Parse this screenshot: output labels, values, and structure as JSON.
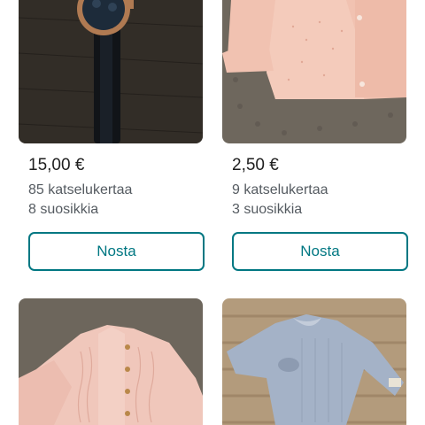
{
  "listings": [
    {
      "image": "wristwatch-photo",
      "price": "15,00 €",
      "views": "85 katselukertaa",
      "favorites": "8 suosikkia",
      "bump_label": "Nosta"
    },
    {
      "image": "pink-knit-cardigan-photo",
      "price": "2,50 €",
      "views": "9 katselukertaa",
      "favorites": "3 suosikkia",
      "bump_label": "Nosta"
    },
    {
      "image": "pink-cable-knit-cardigan-photo"
    },
    {
      "image": "blue-ruffle-collar-bodysuit-photo"
    }
  ],
  "colors": {
    "accent": "#007782",
    "text": "#1f1f1f",
    "muted_text": "#555b61"
  }
}
